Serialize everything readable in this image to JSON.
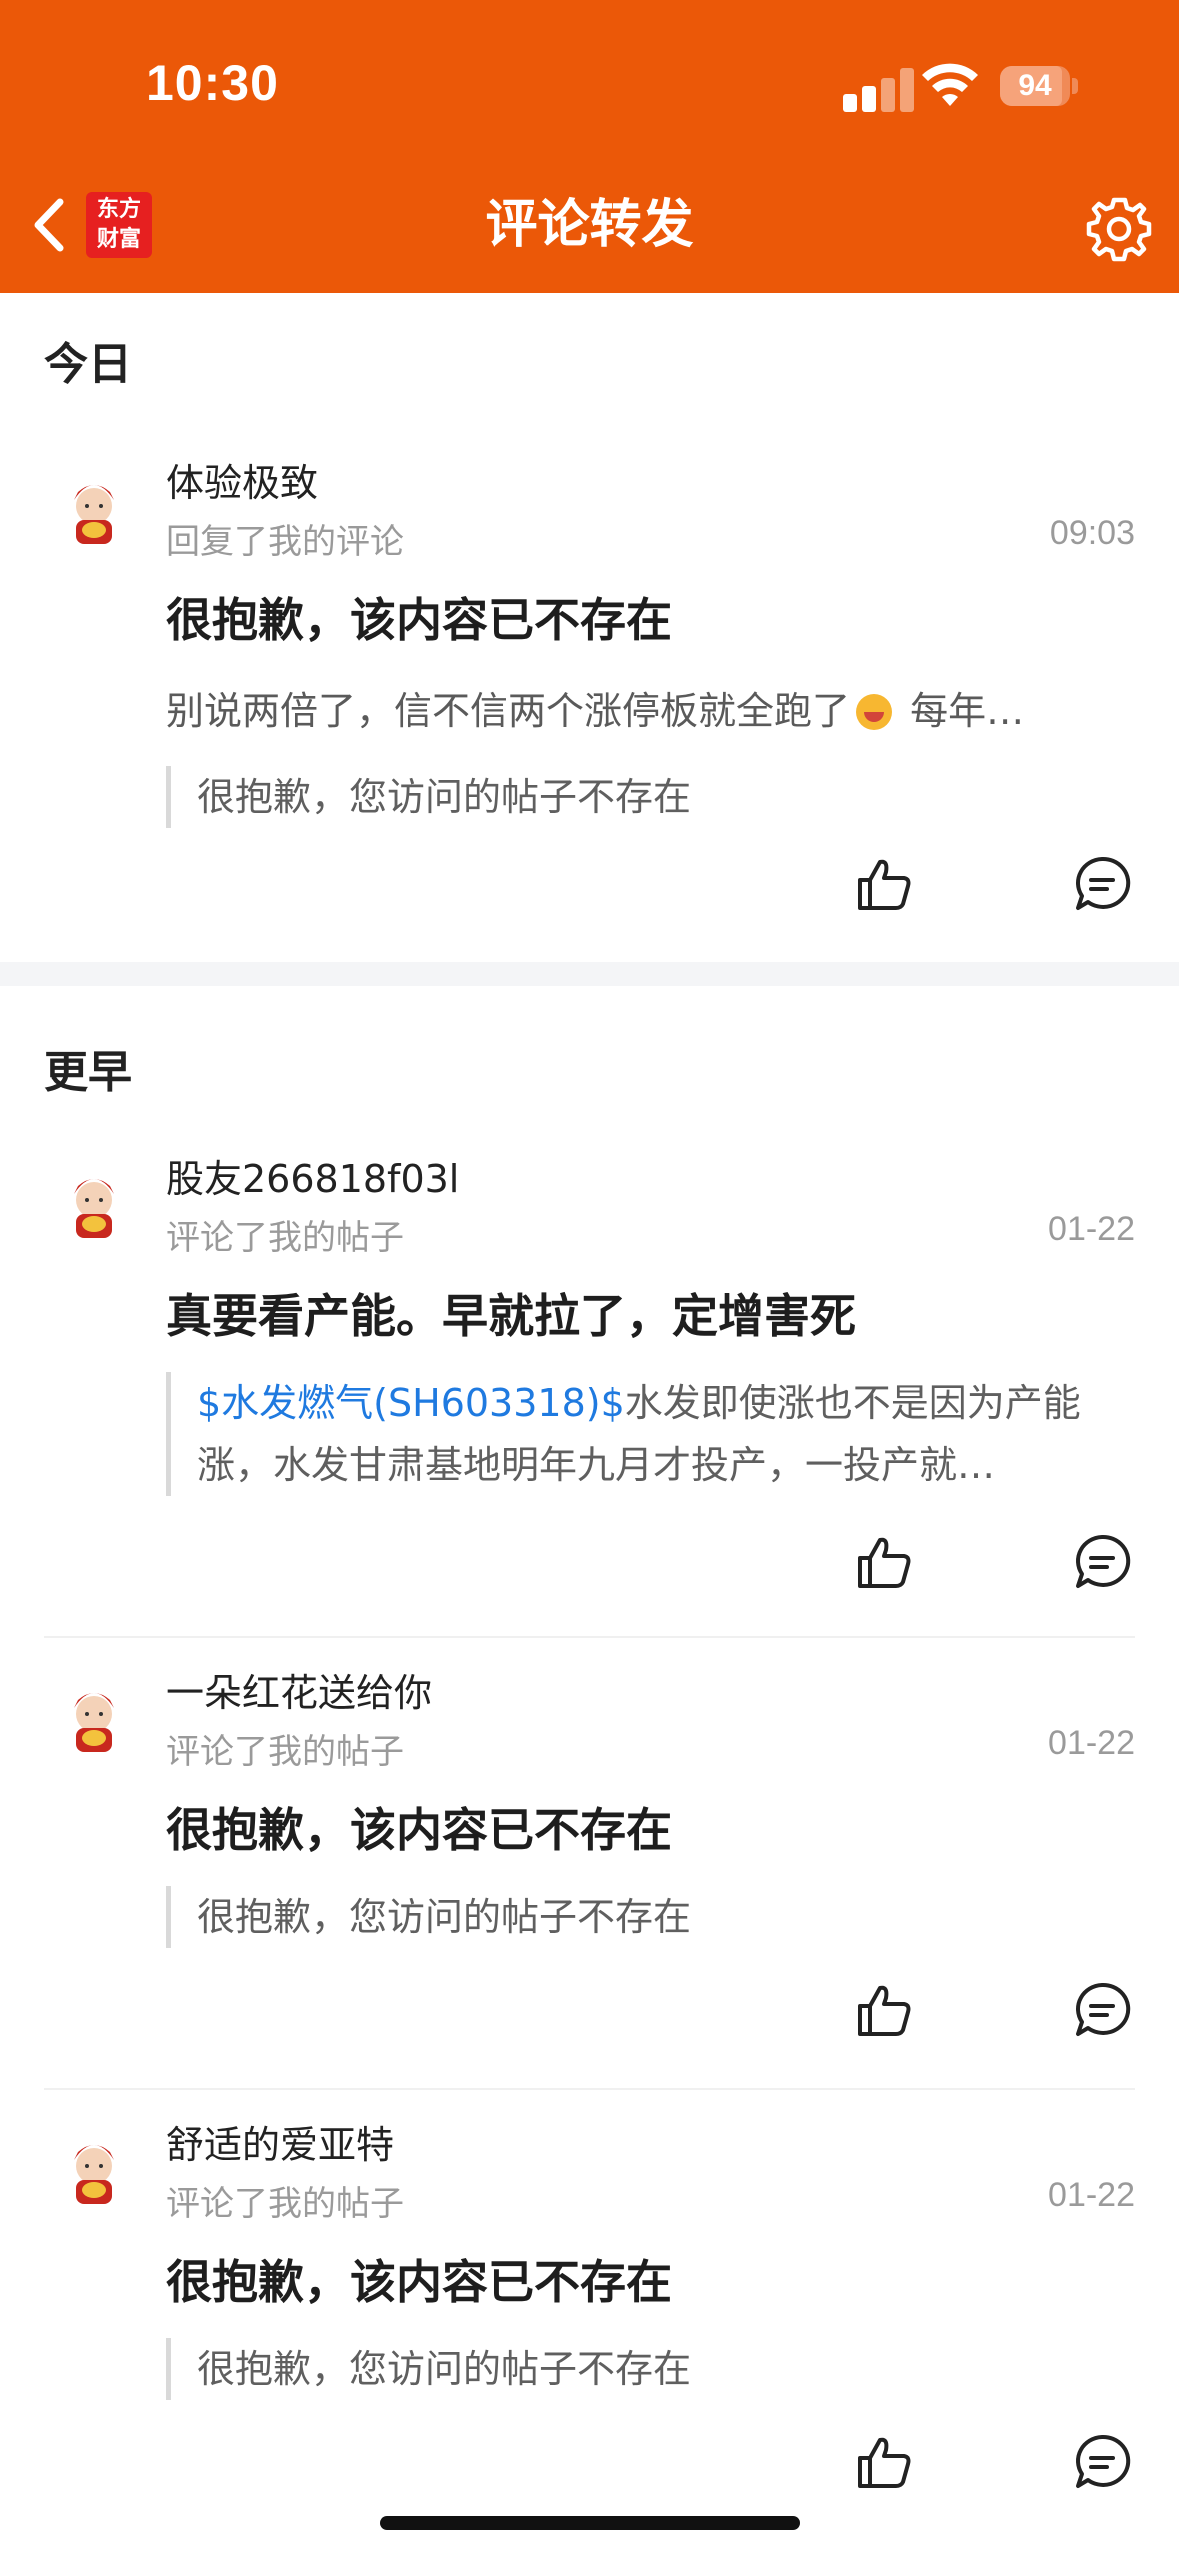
{
  "status_bar": {
    "time": "10:30",
    "battery": "94"
  },
  "header": {
    "title": "评论转发",
    "logo_line1": "东方",
    "logo_line2": "财富"
  },
  "sections": {
    "today": "今日",
    "earlier": "更早"
  },
  "items": [
    {
      "username": "体验极致",
      "action": "回复了我的评论",
      "time": "09:03",
      "headline": "很抱歉，该内容已不存在",
      "reply_text": "别说两倍了，信不信两个涨停板就全跑了",
      "reply_tail": " 每年…",
      "quote": "很抱歉，您访问的帖子不存在"
    },
    {
      "username": "股友266818f03l",
      "action": "评论了我的帖子",
      "time": "01-22",
      "headline": "真要看产能。早就拉了，定增害死",
      "quote_link": "$水发燃气(SH603318)$",
      "quote": "水发即使涨也不是因为产能涨，水发甘肃基地明年九月才投产，一投产就…"
    },
    {
      "username": "一朵红花送给你",
      "action": "评论了我的帖子",
      "time": "01-22",
      "headline": "很抱歉，该内容已不存在",
      "quote": "很抱歉，您访问的帖子不存在"
    },
    {
      "username": "舒适的爱亚特",
      "action": "评论了我的帖子",
      "time": "01-22",
      "headline": "很抱歉，该内容已不存在",
      "quote": "很抱歉，您访问的帖子不存在"
    }
  ],
  "colors": {
    "brand": "#eb5808",
    "link": "#1f7ae0"
  }
}
